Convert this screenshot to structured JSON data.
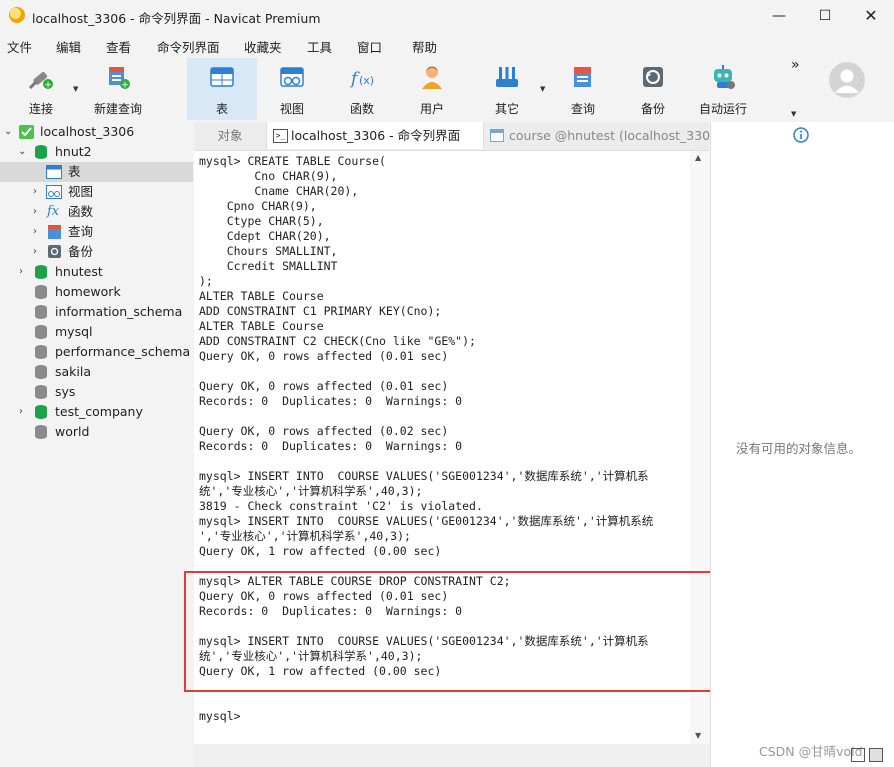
{
  "window": {
    "title": "localhost_3306 - 命令列界面 - Navicat Premium"
  },
  "menu": [
    "文件",
    "编辑",
    "查看",
    "命令列界面",
    "收藏夹",
    "工具",
    "窗口",
    "帮助"
  ],
  "toolbar": {
    "connect": "连接",
    "new_query": "新建查询",
    "table": "表",
    "view": "视图",
    "function": "函数",
    "user": "用户",
    "other": "其它",
    "query": "查询",
    "backup": "备份",
    "automation": "自动运行",
    "more": "»"
  },
  "tree": {
    "connection": "localhost_3306",
    "db_open": "hnut2",
    "children": [
      "表",
      "视图",
      "函数",
      "查询",
      "备份"
    ],
    "databases": [
      "hnutest",
      "homework",
      "information_schema",
      "mysql",
      "performance_schema",
      "sakila",
      "sys",
      "test_company",
      "world"
    ]
  },
  "tabs": {
    "objects": "对象",
    "console": "localhost_3306 - 命令列界面",
    "course": "course @hnutest (localhost_330..."
  },
  "console_lines": [
    "mysql> CREATE TABLE Course(",
    "        Cno CHAR(9),",
    "        Cname CHAR(20),",
    "    Cpno CHAR(9),",
    "    Ctype CHAR(5),",
    "    Cdept CHAR(20),",
    "    Chours SMALLINT,",
    "    Ccredit SMALLINT",
    ");",
    "ALTER TABLE Course",
    "ADD CONSTRAINT C1 PRIMARY KEY(Cno);",
    "ALTER TABLE Course",
    "ADD CONSTRAINT C2 CHECK(Cno like \"GE%\");",
    "Query OK, 0 rows affected (0.01 sec)",
    "",
    "Query OK, 0 rows affected (0.01 sec)",
    "Records: 0  Duplicates: 0  Warnings: 0",
    "",
    "Query OK, 0 rows affected (0.02 sec)",
    "Records: 0  Duplicates: 0  Warnings: 0",
    "",
    "mysql> INSERT INTO  COURSE VALUES('SGE001234','数据库系统','计算机系",
    "统','专业核心','计算机科学系',40,3);",
    "3819 - Check constraint 'C2' is violated.",
    "mysql> INSERT INTO  COURSE VALUES('GE001234','数据库系统','计算机系统",
    "','专业核心','计算机科学系',40,3);",
    "Query OK, 1 row affected (0.00 sec)",
    "",
    "mysql> ALTER TABLE COURSE DROP CONSTRAINT C2;",
    "Query OK, 0 rows affected (0.01 sec)",
    "Records: 0  Duplicates: 0  Warnings: 0",
    "",
    "mysql> INSERT INTO  COURSE VALUES('SGE001234','数据库系统','计算机系",
    "统','专业核心','计算机科学系',40,3);",
    "Query OK, 1 row affected (0.00 sec)",
    "",
    "",
    "mysql>"
  ],
  "right_panel": {
    "message": "没有可用的对象信息。"
  },
  "watermark": "CSDN @甘晴void",
  "colors": {
    "highlight_box": "#e03a3a",
    "active_tool": "#d8e8f6",
    "db_green": "#1ca34a",
    "db_gray": "#8a8a8a"
  }
}
